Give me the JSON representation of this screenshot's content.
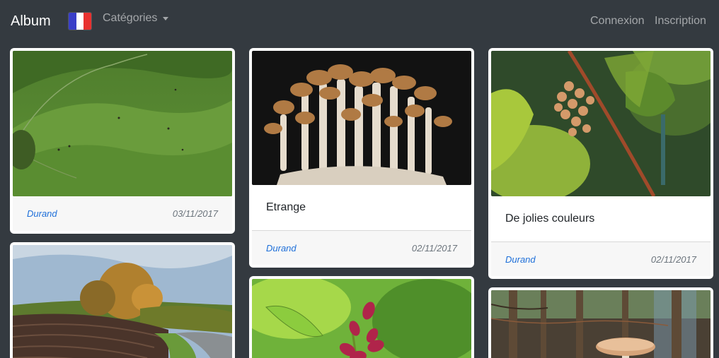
{
  "navbar": {
    "brand": "Album",
    "flag_icon": "france-flag-icon",
    "categories_label": "Catégories",
    "login_label": "Connexion",
    "register_label": "Inscription"
  },
  "cards": [
    {
      "image": "green-hills-photo",
      "title": "",
      "author": "Durand",
      "date": "03/11/2017"
    },
    {
      "image": "mushrooms-photo",
      "title": "Etrange",
      "author": "Durand",
      "date": "02/11/2017"
    },
    {
      "image": "grapes-vine-photo",
      "title": "De jolies couleurs",
      "author": "Durand",
      "date": "02/11/2017"
    },
    {
      "image": "autumn-field-road-photo"
    },
    {
      "image": "pink-buds-photo"
    },
    {
      "image": "forest-mushroom-photo"
    }
  ],
  "colors": {
    "navbar_bg": "#343a40",
    "author_link": "#1e6fd9",
    "footer_bg": "#f7f7f7"
  }
}
